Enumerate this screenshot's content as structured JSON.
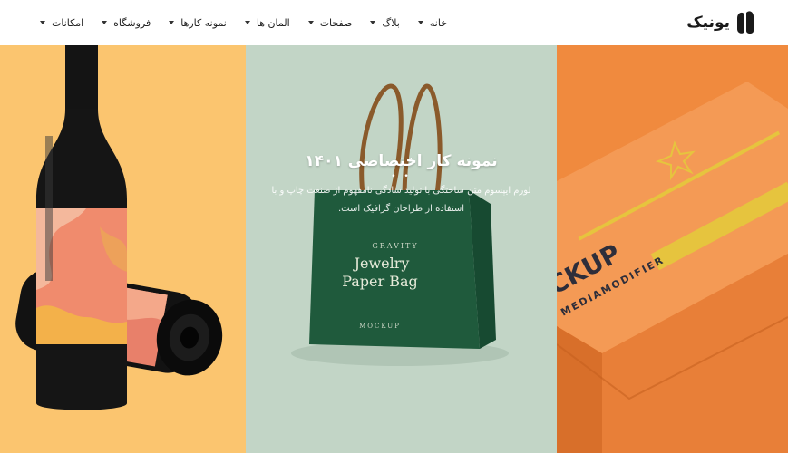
{
  "brand": {
    "name": "یونیک"
  },
  "nav": [
    {
      "label": "خانه",
      "has_dropdown": true
    },
    {
      "label": "بلاگ",
      "has_dropdown": true
    },
    {
      "label": "صفحات",
      "has_dropdown": true
    },
    {
      "label": "المان ها",
      "has_dropdown": true
    },
    {
      "label": "نمونه کارها",
      "has_dropdown": true
    },
    {
      "label": "فروشگاه",
      "has_dropdown": true
    },
    {
      "label": "امکانات",
      "has_dropdown": true
    }
  ],
  "hero": {
    "title": "نمونه کار اختصاصی ۱۴۰۱",
    "dots": "• •",
    "description_line1": "لورم ایپسوم متن ساختگی با تولید سادگی نامفهوم از صنعت چاپ و با",
    "description_line2": "استفاده از طراحان گرافیک است."
  },
  "mockups": {
    "bag_line1": "GRAVITY",
    "bag_line2": "Jewelry",
    "bag_line3": "Paper Bag",
    "bag_line4": "MOCKUP",
    "box_line1": "LOGO MOCKUP",
    "box_line2": "MEDIAMODIFIER"
  },
  "colors": {
    "panel_wine": "#fbc56f",
    "panel_bag": "#c2d5c6",
    "panel_box": "#f08a3e",
    "bag": "#1f5a3c"
  }
}
